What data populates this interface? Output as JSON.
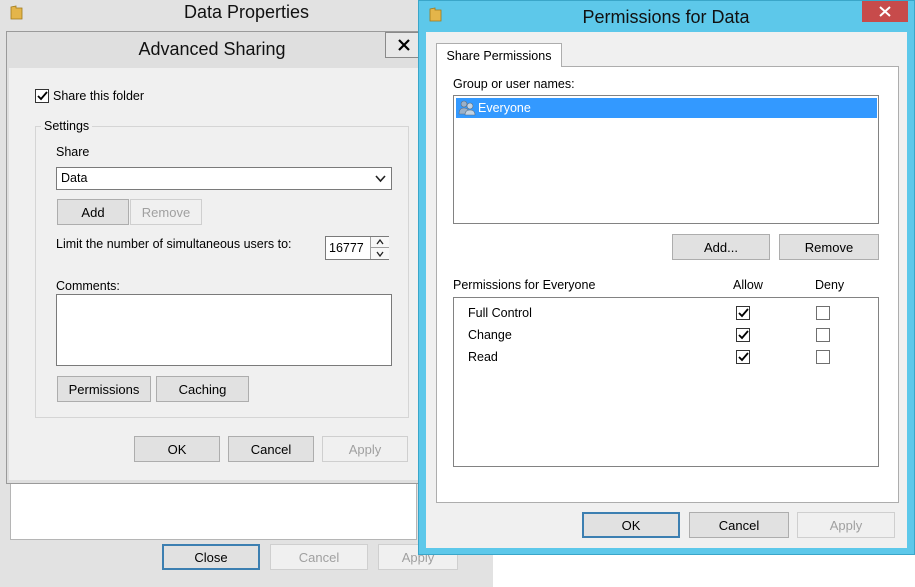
{
  "data_properties": {
    "title": "Data Properties",
    "close_label": "Close",
    "cancel_label": "Cancel",
    "apply_label": "Apply"
  },
  "advanced_sharing": {
    "title": "Advanced Sharing",
    "share_this_folder_label": "Share this folder",
    "share_this_folder_checked": true,
    "settings_label": "Settings",
    "share_label": "Share",
    "share_name": "Data",
    "add_label": "Add",
    "remove_label": "Remove",
    "limit_label": "Limit the number of simultaneous users to:",
    "limit_value": "16777",
    "comments_label": "Comments:",
    "comments_value": "",
    "permissions_label": "Permissions",
    "caching_label": "Caching",
    "ok_label": "OK",
    "cancel_label": "Cancel",
    "apply_label": "Apply"
  },
  "permissions": {
    "title": "Permissions for Data",
    "tab_label": "Share Permissions",
    "group_label": "Group or user names:",
    "users": [
      {
        "name": "Everyone",
        "selected": true
      }
    ],
    "add_label": "Add...",
    "remove_label": "Remove",
    "perm_for_label": "Permissions for Everyone",
    "allow_label": "Allow",
    "deny_label": "Deny",
    "rows": [
      {
        "name": "Full Control",
        "allow": true,
        "deny": false
      },
      {
        "name": "Change",
        "allow": true,
        "deny": false
      },
      {
        "name": "Read",
        "allow": true,
        "deny": false
      }
    ],
    "ok_label": "OK",
    "cancel_label": "Cancel",
    "apply_label": "Apply"
  },
  "colors": {
    "accent_frame": "#5dc8ea",
    "selection": "#3399ff",
    "close_button": "#c74b4b"
  }
}
